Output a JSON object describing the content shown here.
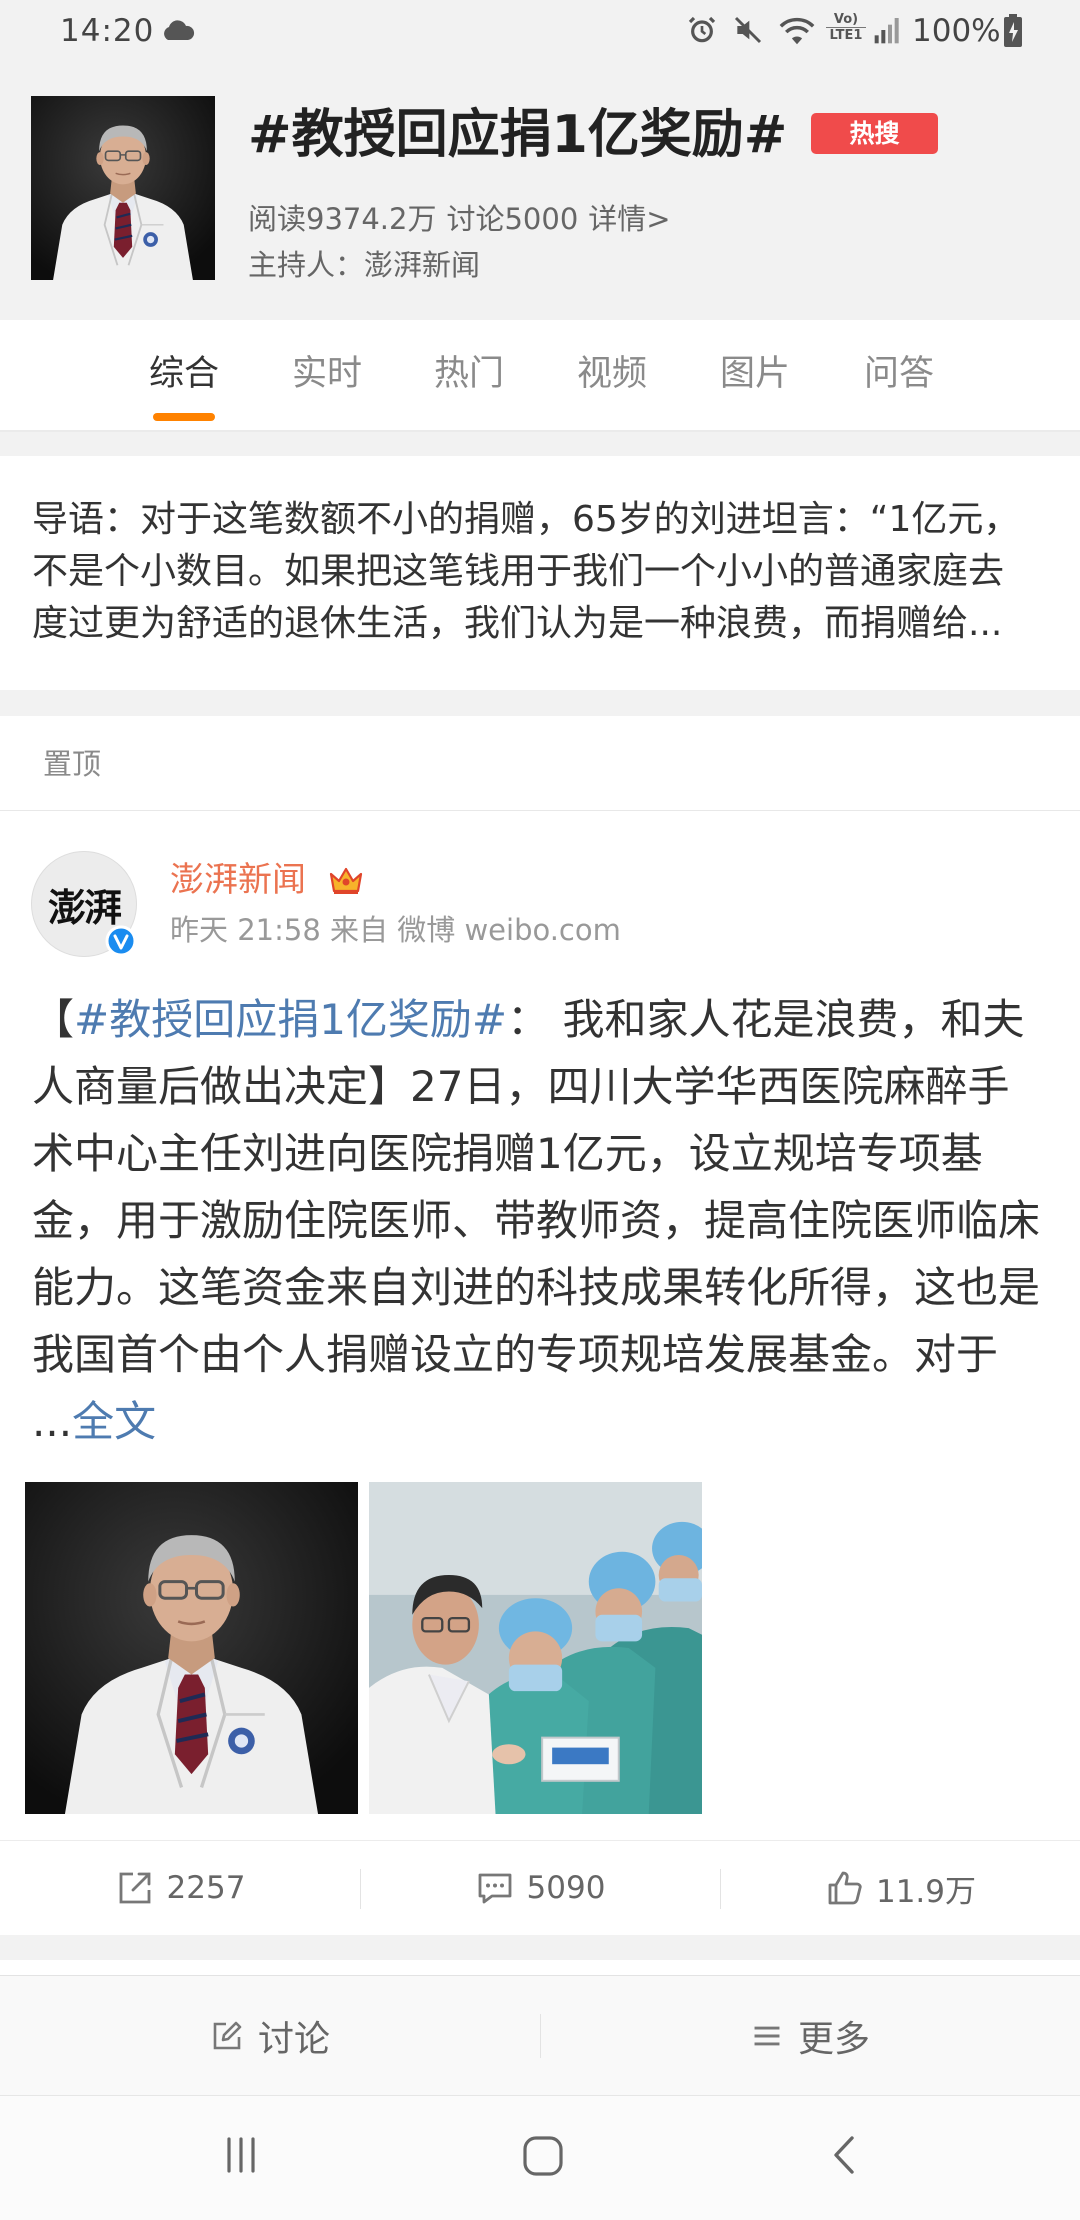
{
  "colors": {
    "accent": "#ff8200",
    "author": "#eb7350",
    "link": "#4e7bb0",
    "badge": "#f04b4b"
  },
  "status_bar": {
    "time": "14:20",
    "volte_top": "Vo)",
    "volte_bottom": "LTE1",
    "battery": "100%",
    "icons": [
      "cloud-icon",
      "alarm-icon",
      "mute-icon",
      "wifi-icon",
      "signal-icon",
      "battery-icon"
    ]
  },
  "topic": {
    "title": "#教授回应捐1亿奖励#",
    "badge": "热搜",
    "reads": "阅读9374.2万",
    "discussions": "讨论5000",
    "details_link": "详情>",
    "host": "主持人：澎湃新闻"
  },
  "tabs": {
    "items": [
      {
        "label": "综合"
      },
      {
        "label": "实时"
      },
      {
        "label": "热门"
      },
      {
        "label": "视频"
      },
      {
        "label": "图片"
      },
      {
        "label": "问答"
      }
    ],
    "active_index": 0
  },
  "intro": {
    "lines": [
      "导语：对于这笔数额不小的捐赠，65岁的刘进坦言：“1亿元，",
      "不是个小数目。如果把这笔钱用于我们一个小小的普通家庭去",
      "度过更为舒适的退休生活，我们认为是一种浪费，而捐赠给..."
    ]
  },
  "pinned": {
    "label": "置顶"
  },
  "post": {
    "author": "澎湃新闻",
    "avatar_text": "澎湃",
    "meta": "昨天 21:58 来自 微博 weibo.com",
    "text": {
      "open_bracket": "【",
      "hashtag": "#教授回应捐1亿奖励#",
      "first_line_rest": "： 我和家人花是浪费，和夫",
      "lines": [
        "人商量后做出决定】27日，四川大学华西医院麻醉手",
        "术中心主任刘进向医院捐赠1亿元，设立规培专项基",
        "金，用于激励住院医师、带教师资，提高住院医师临床",
        "能力。这笔资金来自刘进的科技成果转化所得，这也是",
        "我国首个由个人捐赠设立的专项规培发展基金。对于"
      ],
      "ellipsis": "...",
      "more_link": "全文"
    },
    "actions": {
      "reposts": "2257",
      "comments": "5090",
      "likes": "11.9万",
      "icons": [
        "repost-icon",
        "comment-icon",
        "like-icon"
      ]
    }
  },
  "bottom_bar": {
    "discuss": "讨论",
    "more": "更多",
    "icons": [
      "edit-icon",
      "menu-icon"
    ]
  },
  "nav_bar": {
    "icons": [
      "recent-apps-icon",
      "home-icon",
      "back-icon"
    ]
  }
}
